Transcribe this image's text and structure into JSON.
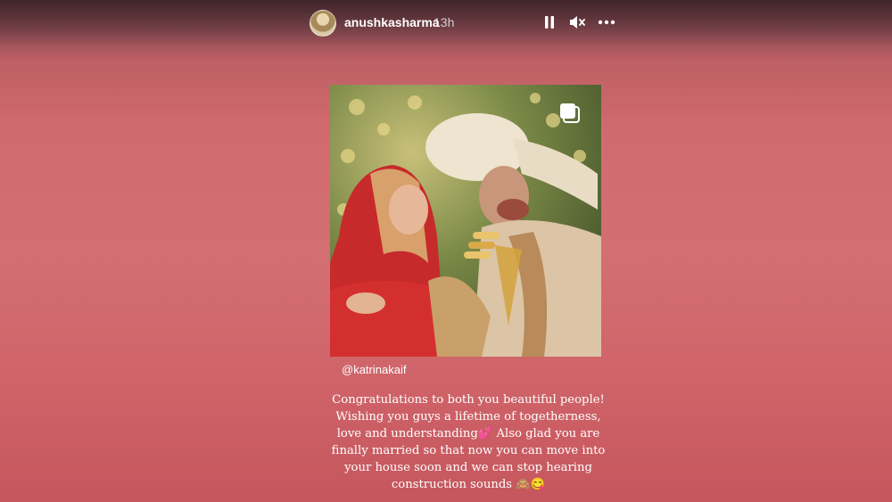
{
  "story": {
    "username": "anushkasharma",
    "timestamp": "13h"
  },
  "icons": {
    "pause": "pause-icon",
    "mute": "speaker-muted-icon",
    "more": "more-horizontal-icon",
    "multi": "multiple-posts-icon"
  },
  "post": {
    "mention": "@katrinakaif",
    "caption_lines": [
      "Congratulations to both you beautiful people!",
      "Wishing you guys a lifetime of togetherness,",
      "love and understanding💕 Also glad you are",
      "finally married so that now you can move into",
      "your house soon and we can stop hearing",
      "construction sounds 🙈😋"
    ]
  },
  "colors": {
    "background": "#d36f73",
    "text": "#ffffff"
  }
}
